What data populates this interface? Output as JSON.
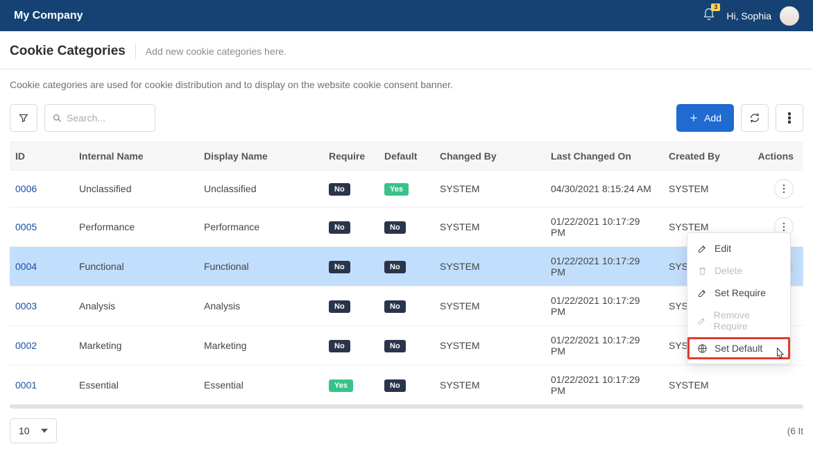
{
  "header": {
    "brand": "My Company",
    "notification_count": "3",
    "greeting": "Hi, Sophia"
  },
  "page": {
    "title": "Cookie Categories",
    "subtitle": "Add new cookie categories here.",
    "description": "Cookie categories are used for cookie distribution and to display on the website cookie consent banner."
  },
  "toolbar": {
    "search_placeholder": "Search...",
    "add_label": "Add"
  },
  "table": {
    "columns": {
      "id": "ID",
      "internal": "Internal Name",
      "display": "Display Name",
      "require": "Require",
      "default": "Default",
      "changed_by": "Changed By",
      "last_changed": "Last Changed On",
      "created_by": "Created By",
      "actions": "Actions"
    },
    "pill_no": "No",
    "pill_yes": "Yes",
    "rows": [
      {
        "id": "0006",
        "internal": "Unclassified",
        "display": "Unclassified",
        "require": "No",
        "default": "Yes",
        "changed_by": "SYSTEM",
        "last_changed": "04/30/2021 8:15:24 AM",
        "created_by": "SYSTEM"
      },
      {
        "id": "0005",
        "internal": "Performance",
        "display": "Performance",
        "require": "No",
        "default": "No",
        "changed_by": "SYSTEM",
        "last_changed": "01/22/2021 10:17:29 PM",
        "created_by": "SYSTEM"
      },
      {
        "id": "0004",
        "internal": "Functional",
        "display": "Functional",
        "require": "No",
        "default": "No",
        "changed_by": "SYSTEM",
        "last_changed": "01/22/2021 10:17:29 PM",
        "created_by": "SYSTEM"
      },
      {
        "id": "0003",
        "internal": "Analysis",
        "display": "Analysis",
        "require": "No",
        "default": "No",
        "changed_by": "SYSTEM",
        "last_changed": "01/22/2021 10:17:29 PM",
        "created_by": "SYSTEM"
      },
      {
        "id": "0002",
        "internal": "Marketing",
        "display": "Marketing",
        "require": "No",
        "default": "No",
        "changed_by": "SYSTEM",
        "last_changed": "01/22/2021 10:17:29 PM",
        "created_by": "SYSTEM"
      },
      {
        "id": "0001",
        "internal": "Essential",
        "display": "Essential",
        "require": "Yes",
        "default": "No",
        "changed_by": "SYSTEM",
        "last_changed": "01/22/2021 10:17:29 PM",
        "created_by": "SYSTEM"
      }
    ]
  },
  "footer": {
    "page_size": "10",
    "count_label": "(6 It"
  },
  "menu": {
    "edit": "Edit",
    "delete": "Delete",
    "set_require": "Set Require",
    "remove_require": "Remove Require",
    "set_default": "Set Default"
  }
}
